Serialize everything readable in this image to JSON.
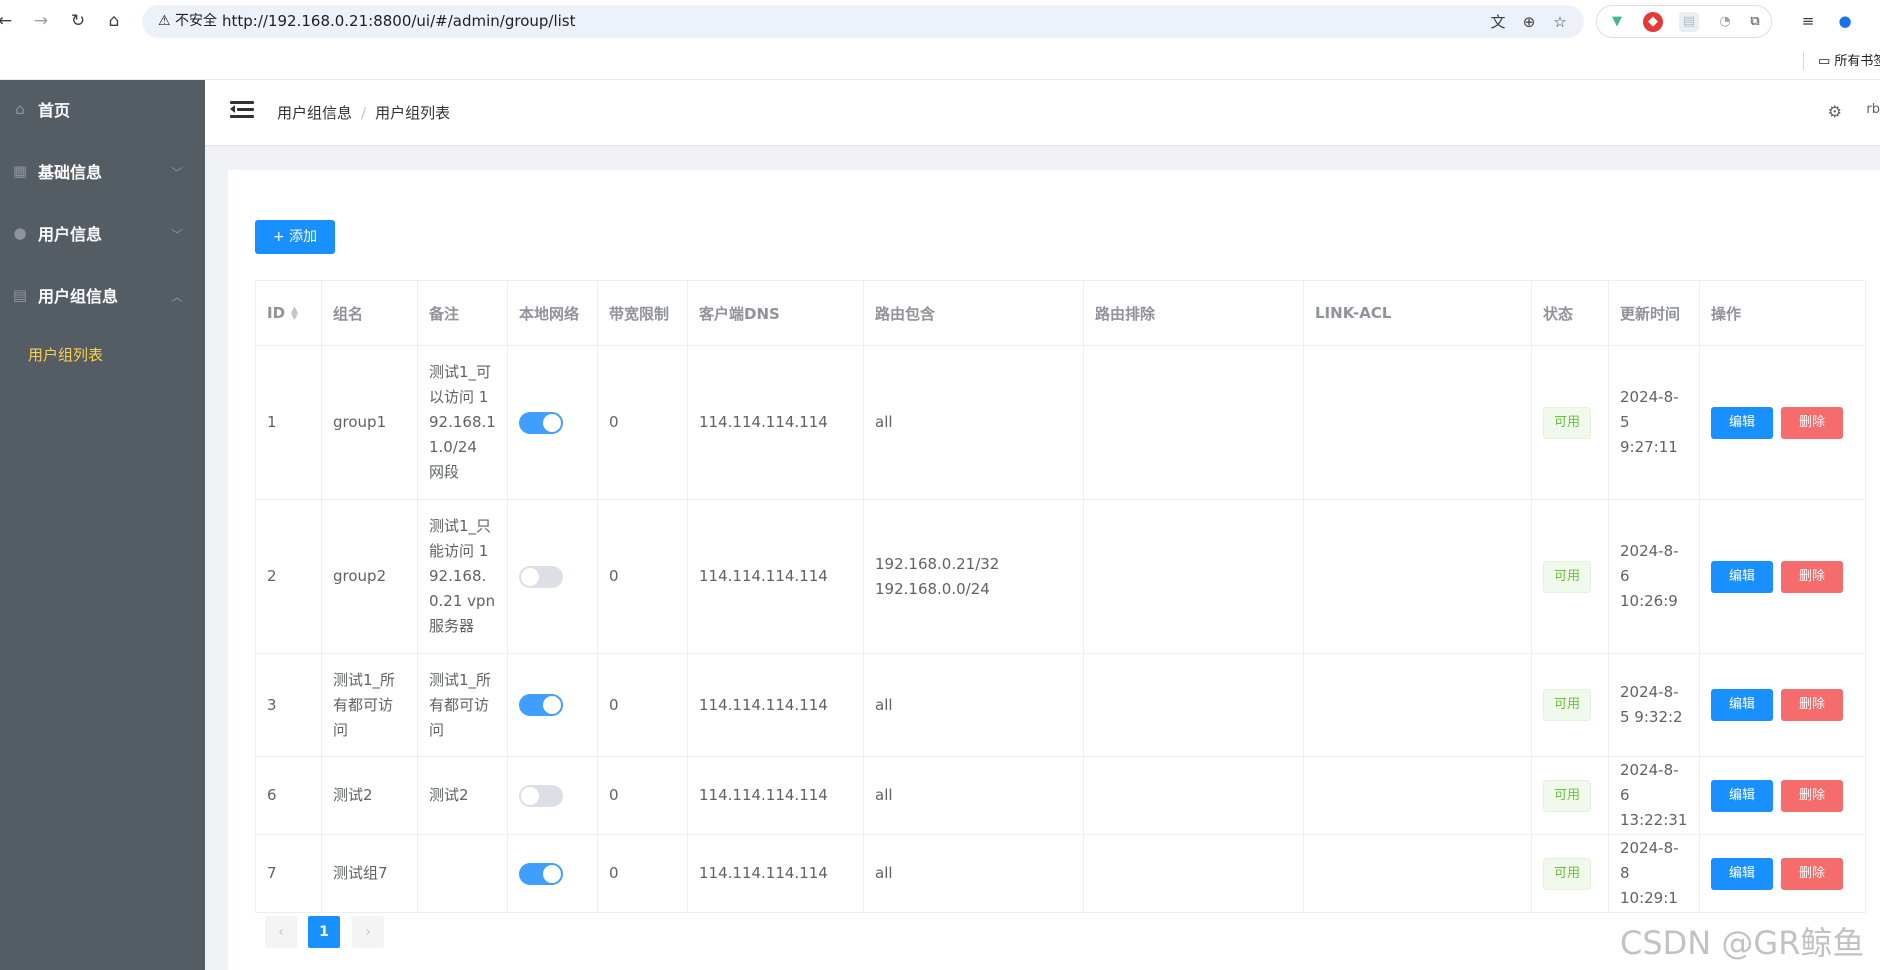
{
  "browser": {
    "security_label": "⚠ 不安全",
    "url": "http://192.168.0.21:8800/ui/#/admin/group/list",
    "bookmarks_folder": "所有书签"
  },
  "sidebar": {
    "items": [
      {
        "label": "首页",
        "icon": "home-icon"
      },
      {
        "label": "基础信息",
        "icon": "grid-icon"
      },
      {
        "label": "用户信息",
        "icon": "user-icon"
      },
      {
        "label": "用户组信息",
        "icon": "clipboard-icon"
      }
    ],
    "submenu_active": "用户组列表"
  },
  "header": {
    "breadcrumb": [
      "用户组信息",
      "用户组列表"
    ],
    "user_label": "rb"
  },
  "toolbar": {
    "add_label": "+ 添加"
  },
  "table": {
    "columns": [
      "ID",
      "组名",
      "备注",
      "本地网络",
      "带宽限制",
      "客户端DNS",
      "路由包含",
      "路由排除",
      "LINK-ACL",
      "状态",
      "更新时间",
      "操作"
    ],
    "rows": [
      {
        "id": "1",
        "name": "group1",
        "note": "测试1_可以访问 192.168.11.0/24 网段",
        "local_net": true,
        "bandwidth": "0",
        "dns": "114.114.114.114",
        "route_include": "all",
        "route_exclude": "",
        "link_acl": "",
        "status": "可用",
        "updated": "2024-8-5 9:27:11"
      },
      {
        "id": "2",
        "name": "group2",
        "note": "测试1_只能访问 192.168.0.21 vpn服务器",
        "local_net": false,
        "bandwidth": "0",
        "dns": "114.114.114.114",
        "route_include": "192.168.0.21/32\n192.168.0.0/24",
        "route_exclude": "",
        "link_acl": "",
        "status": "可用",
        "updated": "2024-8-6 10:26:9"
      },
      {
        "id": "3",
        "name": "测试1_所有都可访问",
        "note": "测试1_所有都可访问",
        "local_net": true,
        "bandwidth": "0",
        "dns": "114.114.114.114",
        "route_include": "all",
        "route_exclude": "",
        "link_acl": "",
        "status": "可用",
        "updated": "2024-8-5 9:32:2"
      },
      {
        "id": "6",
        "name": "测试2",
        "note": "测试2",
        "local_net": false,
        "bandwidth": "0",
        "dns": "114.114.114.114",
        "route_include": "all",
        "route_exclude": "",
        "link_acl": "",
        "status": "可用",
        "updated": "2024-8-6 13:22:31"
      },
      {
        "id": "7",
        "name": "测试组7",
        "note": "",
        "local_net": true,
        "bandwidth": "0",
        "dns": "114.114.114.114",
        "route_include": "all",
        "route_exclude": "",
        "link_acl": "",
        "status": "可用",
        "updated": "2024-8-8 10:29:1"
      }
    ],
    "edit_label": "编辑",
    "delete_label": "删除"
  },
  "pagination": {
    "prev": "‹",
    "current": "1",
    "next": "›"
  },
  "watermark": "CSDN @GR鲸鱼",
  "colors": {
    "sidebar_bg": "#545c64",
    "sidebar_active": "#ffd04b",
    "primary": "#1890ff",
    "danger": "#f56c6c",
    "success": "#67c23a"
  }
}
